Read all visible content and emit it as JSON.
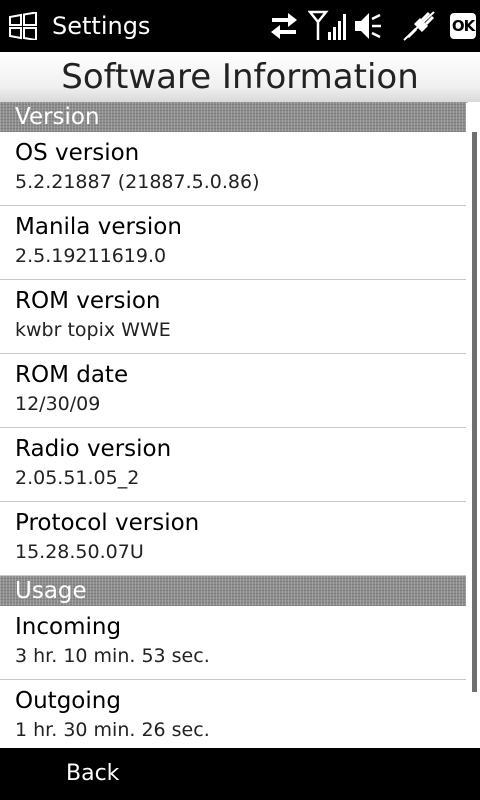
{
  "topbar": {
    "app_title": "Settings",
    "ok_label": "OK",
    "icons": [
      "windows-start-icon",
      "data-transfer-icon",
      "signal-strength-icon",
      "speaker-muted-icon",
      "charging-plug-icon"
    ]
  },
  "page": {
    "title": "Software Information"
  },
  "sections": [
    {
      "header": "Version",
      "items": [
        {
          "label": "OS version",
          "value": "5.2.21887 (21887.5.0.86)"
        },
        {
          "label": "Manila version",
          "value": "2.5.19211619.0"
        },
        {
          "label": "ROM version",
          "value": "kwbr topix WWE"
        },
        {
          "label": "ROM date",
          "value": "12/30/09"
        },
        {
          "label": "Radio version",
          "value": "2.05.51.05_2"
        },
        {
          "label": "Protocol version",
          "value": "15.28.50.07U"
        }
      ]
    },
    {
      "header": "Usage",
      "items": [
        {
          "label": "Incoming",
          "value": "3 hr. 10 min. 53 sec."
        },
        {
          "label": "Outgoing",
          "value": "1 hr. 30 min. 26 sec."
        }
      ]
    }
  ],
  "bottombar": {
    "back_label": "Back"
  }
}
